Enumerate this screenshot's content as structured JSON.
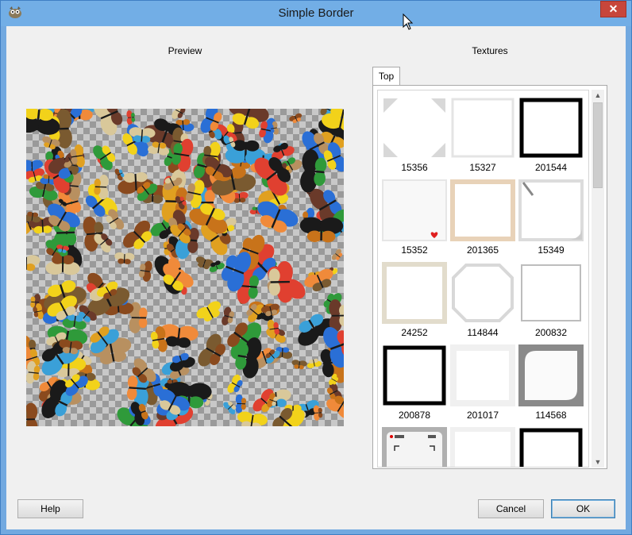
{
  "window": {
    "title": "Simple Border",
    "close_label": "✕"
  },
  "labels": {
    "preview": "Preview",
    "textures": "Textures"
  },
  "tabs": [
    {
      "label": "Top"
    }
  ],
  "textures": [
    {
      "id": "15356"
    },
    {
      "id": "15327"
    },
    {
      "id": "201544"
    },
    {
      "id": "15352"
    },
    {
      "id": "201365"
    },
    {
      "id": "15349"
    },
    {
      "id": "24252"
    },
    {
      "id": "114844"
    },
    {
      "id": "200832"
    },
    {
      "id": "200878"
    },
    {
      "id": "201017"
    },
    {
      "id": "114568"
    }
  ],
  "buttons": {
    "help": "Help",
    "cancel": "Cancel",
    "ok": "OK"
  },
  "scrollbar": {
    "up_icon": "▲",
    "down_icon": "▼"
  },
  "colors": {
    "titlebar": "#72aee6",
    "close": "#c7463b",
    "client": "#f0f0f0"
  }
}
